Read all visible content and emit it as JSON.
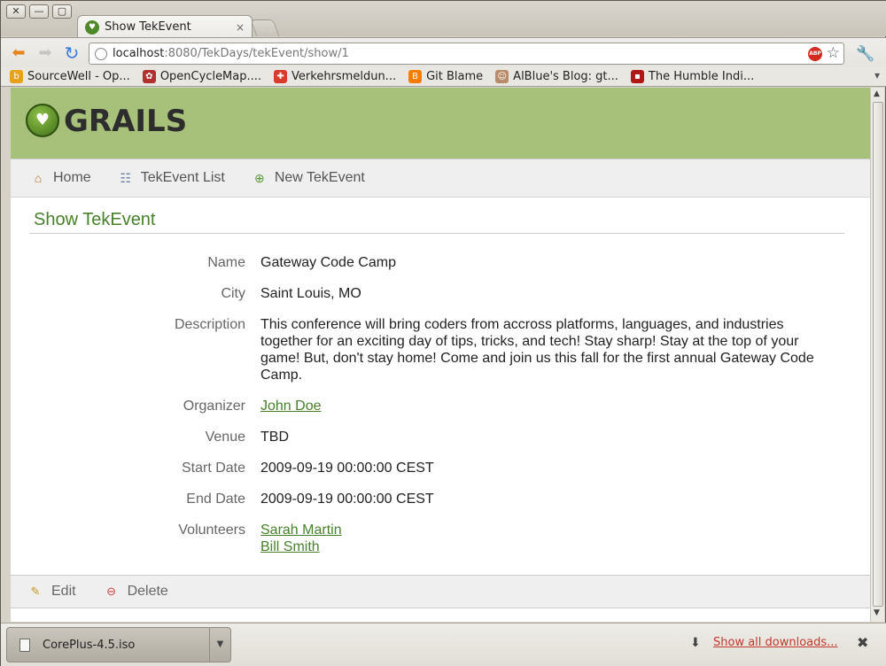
{
  "browser": {
    "window_buttons": [
      "✕",
      "—",
      "▢"
    ],
    "tab": {
      "title": "Show TekEvent",
      "close": "×"
    },
    "address": {
      "host": "localhost",
      "path": ":8080/TekDays/tekEvent/show/1"
    },
    "adblock_badge": "ABP",
    "bookmarks": [
      {
        "label": "SourceWell - Op...",
        "icon": "bookmark-sourcewell-icon",
        "color": "#e8a21a",
        "glyph": "b"
      },
      {
        "label": "OpenCycleMap....",
        "icon": "bookmark-opencyclemap-icon",
        "color": "#b23030",
        "glyph": "✿"
      },
      {
        "label": "Verkehrsmeldun...",
        "icon": "bookmark-verkehr-icon",
        "color": "#d63b2b",
        "glyph": "✚"
      },
      {
        "label": "Git Blame",
        "icon": "bookmark-blogger-icon",
        "color": "#f57d00",
        "glyph": "B"
      },
      {
        "label": "AlBlue's Blog: gt...",
        "icon": "bookmark-alblue-icon",
        "color": "#b98c6b",
        "glyph": "☺"
      },
      {
        "label": "The Humble Indi...",
        "icon": "bookmark-humble-icon",
        "color": "#b01818",
        "glyph": "▪"
      }
    ],
    "bookmarks_more": "▾"
  },
  "page": {
    "logo_text": "GRAILS",
    "nav": {
      "home": "Home",
      "list": "TekEvent List",
      "new": "New TekEvent"
    },
    "title": "Show TekEvent",
    "properties": [
      {
        "name": "Name",
        "value": "Gateway Code Camp"
      },
      {
        "name": "City",
        "value": "Saint Louis, MO"
      },
      {
        "name": "Description",
        "value": "This conference will bring coders from accross platforms, languages, and industries together for an exciting day of tips, tricks, and tech! Stay sharp! Stay at the top of your game! But, don't stay home! Come and join us this fall for the first annual Gateway Code Camp."
      },
      {
        "name": "Organizer",
        "link": "John Doe"
      },
      {
        "name": "Venue",
        "value": "TBD"
      },
      {
        "name": "Start Date",
        "value": "2009-09-19 00:00:00 CEST"
      },
      {
        "name": "End Date",
        "value": "2009-09-19 00:00:00 CEST"
      },
      {
        "name": "Volunteers",
        "links": [
          "Sarah Martin",
          "Bill Smith"
        ]
      }
    ],
    "buttons": {
      "edit": "Edit",
      "delete": "Delete"
    }
  },
  "downloads": {
    "file": "CorePlus-4.5.iso",
    "dropdown": "▼",
    "show_all": "Show all downloads...",
    "close": "✖"
  },
  "colors": {
    "header_green": "#a7c07a",
    "link_green": "#48802c",
    "download_link": "#c0392b"
  }
}
